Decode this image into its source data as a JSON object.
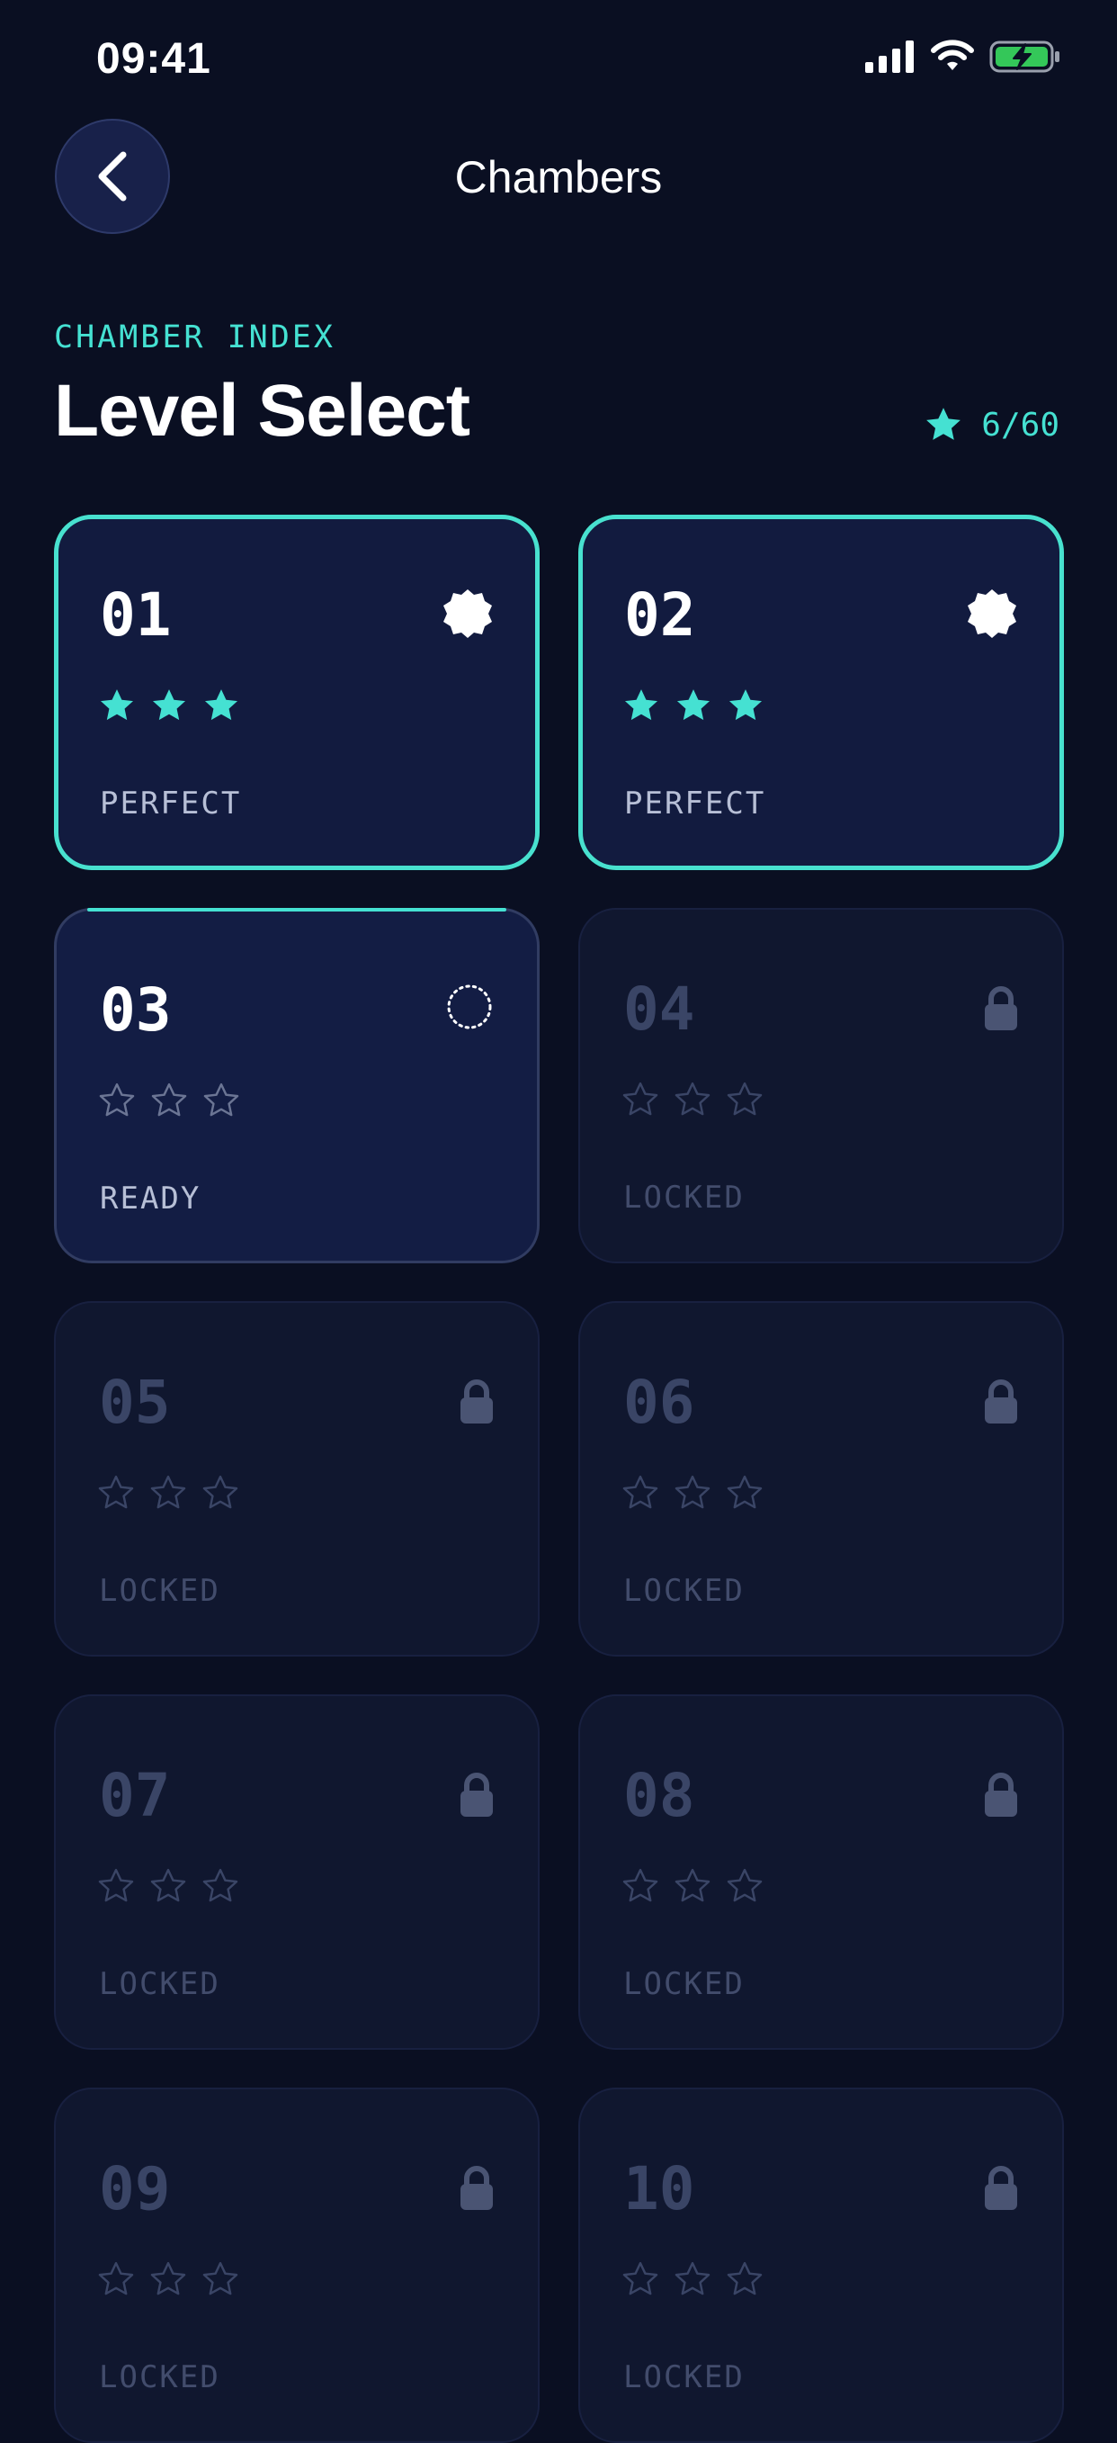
{
  "status_bar": {
    "time": "09:41"
  },
  "nav": {
    "title": "Chambers",
    "back_icon": "chevron-left-icon"
  },
  "header": {
    "eyebrow": "CHAMBER INDEX",
    "title": "Level Select",
    "stars_total": "6/60"
  },
  "colors": {
    "accent": "#45e1d2",
    "background": "#0a0f22",
    "locked_text": "#3a4566"
  },
  "levels": [
    {
      "number": "01",
      "status": "PERFECT",
      "state": "perfect",
      "stars": 3,
      "icon": "badge-icon"
    },
    {
      "number": "02",
      "status": "PERFECT",
      "state": "perfect",
      "stars": 3,
      "icon": "badge-icon"
    },
    {
      "number": "03",
      "status": "READY",
      "state": "ready",
      "stars": 0,
      "icon": "dotted-circle-icon"
    },
    {
      "number": "04",
      "status": "LOCKED",
      "state": "locked",
      "stars": 0,
      "icon": "lock-icon"
    },
    {
      "number": "05",
      "status": "LOCKED",
      "state": "locked",
      "stars": 0,
      "icon": "lock-icon"
    },
    {
      "number": "06",
      "status": "LOCKED",
      "state": "locked",
      "stars": 0,
      "icon": "lock-icon"
    },
    {
      "number": "07",
      "status": "LOCKED",
      "state": "locked",
      "stars": 0,
      "icon": "lock-icon"
    },
    {
      "number": "08",
      "status": "LOCKED",
      "state": "locked",
      "stars": 0,
      "icon": "lock-icon"
    },
    {
      "number": "09",
      "status": "LOCKED",
      "state": "locked",
      "stars": 0,
      "icon": "lock-icon"
    },
    {
      "number": "10",
      "status": "LOCKED",
      "state": "locked",
      "stars": 0,
      "icon": "lock-icon"
    }
  ]
}
